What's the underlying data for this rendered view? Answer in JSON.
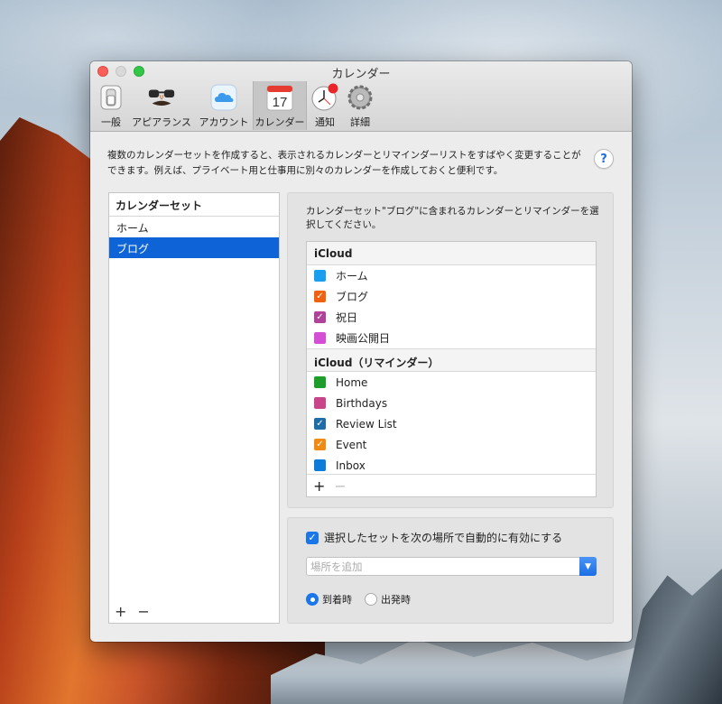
{
  "window": {
    "title": "カレンダー"
  },
  "toolbar": {
    "items": [
      {
        "label": "一般",
        "icon": "general-switch-icon"
      },
      {
        "label": "アピアランス",
        "icon": "disguise-glasses-icon"
      },
      {
        "label": "アカウント",
        "icon": "icloud-account-icon"
      },
      {
        "label": "カレンダー",
        "icon": "calendar-17-icon",
        "day": "17",
        "active": true
      },
      {
        "label": "通知",
        "icon": "clock-notification-icon"
      },
      {
        "label": "詳細",
        "icon": "gear-icon"
      }
    ]
  },
  "description": "複数のカレンダーセットを作成すると、表示されるカレンダーとリマインダーリストをすばやく変更することができます。例えば、プライベート用と仕事用に別々のカレンダーを作成しておくと便利です。",
  "help": {
    "label": "?"
  },
  "calendar_sets": {
    "header": "カレンダーセット",
    "items": [
      {
        "label": "ホーム",
        "selected": false
      },
      {
        "label": "ブログ",
        "selected": true
      }
    ],
    "add_label": "+",
    "remove_label": "−"
  },
  "selection": {
    "description": "カレンダーセット\"ブログ\"に含まれるカレンダーとリマインダーを選択してください。",
    "group1": {
      "header": "iCloud",
      "items": [
        {
          "label": "ホーム",
          "color": "#1a9ff0",
          "checked": false
        },
        {
          "label": "ブログ",
          "color": "#f0620f",
          "checked": true
        },
        {
          "label": "祝日",
          "color": "#b04299",
          "checked": true
        },
        {
          "label": "映画公開日",
          "color": "#d44fd6",
          "checked": false
        }
      ]
    },
    "group2": {
      "header": "iCloud（リマインダー）",
      "items": [
        {
          "label": "Home",
          "color": "#1d9e2a",
          "checked": false
        },
        {
          "label": "Birthdays",
          "color": "#c9458a",
          "checked": false
        },
        {
          "label": "Review List",
          "color": "#1f6da6",
          "checked": true
        },
        {
          "label": "Event",
          "color": "#f08a12",
          "checked": true
        },
        {
          "label": "Inbox",
          "color": "#0d7cd8",
          "checked": false
        }
      ]
    },
    "add_label": "+",
    "remove_label": "−"
  },
  "auto_enable": {
    "checkbox_label": "選択したセットを次の場所で自動的に有効にする",
    "checked": true,
    "location_placeholder": "場所を追加",
    "radio": [
      {
        "label": "到着時",
        "selected": true
      },
      {
        "label": "出発時",
        "selected": false
      }
    ]
  }
}
